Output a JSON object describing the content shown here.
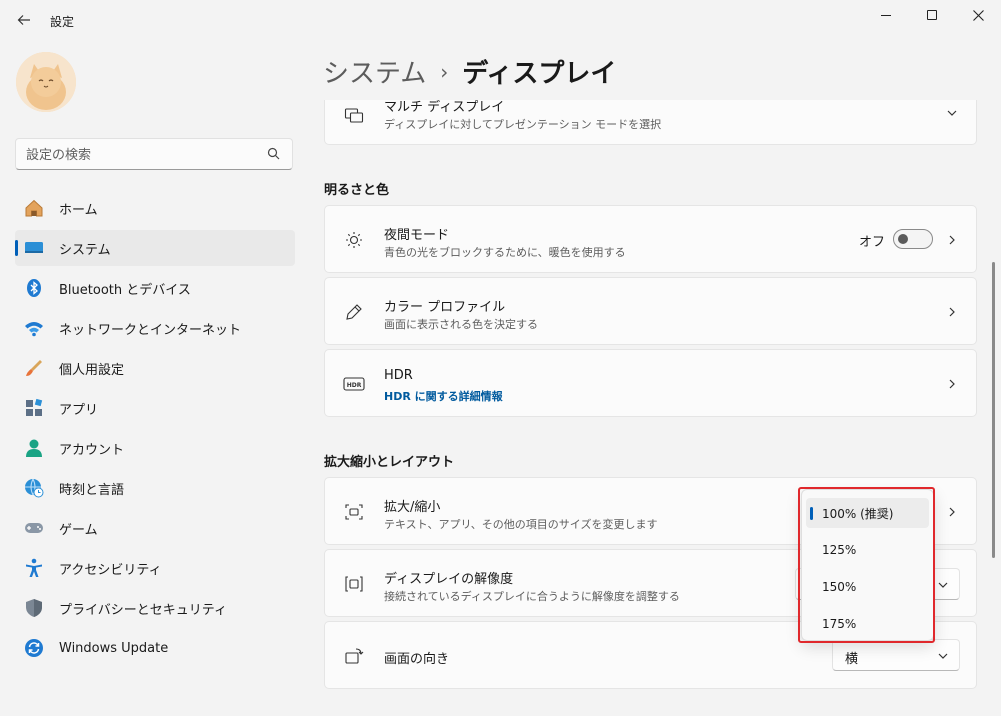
{
  "window": {
    "title": "設定"
  },
  "search": {
    "placeholder": "設定の検索"
  },
  "nav": {
    "items": [
      {
        "label": "ホーム",
        "icon": "home-icon"
      },
      {
        "label": "システム",
        "icon": "system-icon",
        "active": true
      },
      {
        "label": "Bluetooth とデバイス",
        "icon": "bluetooth-icon"
      },
      {
        "label": "ネットワークとインターネット",
        "icon": "wifi-icon"
      },
      {
        "label": "個人用設定",
        "icon": "brush-icon"
      },
      {
        "label": "アプリ",
        "icon": "apps-icon"
      },
      {
        "label": "アカウント",
        "icon": "account-icon"
      },
      {
        "label": "時刻と言語",
        "icon": "globe-clock-icon"
      },
      {
        "label": "ゲーム",
        "icon": "gamepad-icon"
      },
      {
        "label": "アクセシビリティ",
        "icon": "accessibility-icon"
      },
      {
        "label": "プライバシーとセキュリティ",
        "icon": "shield-icon"
      },
      {
        "label": "Windows Update",
        "icon": "update-icon"
      }
    ]
  },
  "breadcrumb": {
    "parent": "システム",
    "separator": "›",
    "current": "ディスプレイ"
  },
  "cards": {
    "multi_display": {
      "title": "マルチ ディスプレイ",
      "sub": "ディスプレイに対してプレゼンテーション モードを選択"
    },
    "night_light": {
      "title": "夜間モード",
      "sub": "青色の光をブロックするために、暖色を使用する",
      "toggle_label": "オフ"
    },
    "color_profile": {
      "title": "カラー プロファイル",
      "sub": "画面に表示される色を決定する"
    },
    "hdr": {
      "title": "HDR",
      "link": "HDR に関する詳細情報"
    },
    "scale": {
      "title": "拡大/縮小",
      "sub": "テキスト、アプリ、その他の項目のサイズを変更します"
    },
    "resolution": {
      "title": "ディスプレイの解像度",
      "sub": "接続されているディスプレイに合うように解像度を調整する"
    },
    "orientation": {
      "title": "画面の向き",
      "value": "横"
    }
  },
  "sections": {
    "brightness": "明るさと色",
    "scale_layout": "拡大縮小とレイアウト"
  },
  "scale_dropdown": {
    "options": [
      "100% (推奨)",
      "125%",
      "150%",
      "175%"
    ],
    "selected_index": 0
  },
  "colors": {
    "accent": "#005fb8",
    "highlight": "#e0282c",
    "link": "#005a9e"
  }
}
